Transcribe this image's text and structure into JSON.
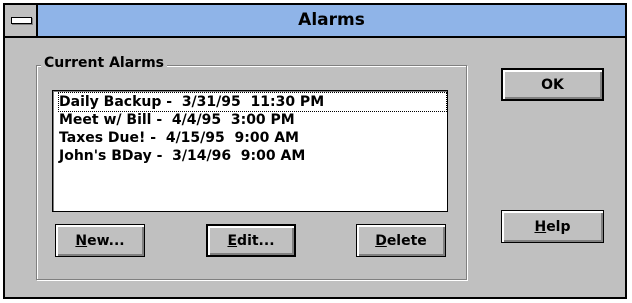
{
  "window": {
    "title": "Alarms"
  },
  "group": {
    "label": "Current Alarms"
  },
  "alarms": [
    {
      "text": "Daily Backup -  3/31/95  11:30 PM"
    },
    {
      "text": "Meet w/ Bill -  4/4/95  3:00 PM"
    },
    {
      "text": "Taxes Due! -  4/15/95  9:00 AM"
    },
    {
      "text": "John's BDay -  3/14/96  9:00 AM"
    }
  ],
  "buttons": {
    "ok": "OK",
    "help": {
      "accel": "H",
      "rest": "elp"
    },
    "new": {
      "accel": "N",
      "rest": "ew..."
    },
    "edit": {
      "accel": "E",
      "rest": "dit..."
    },
    "delete": {
      "accel": "D",
      "rest": "elete"
    }
  }
}
